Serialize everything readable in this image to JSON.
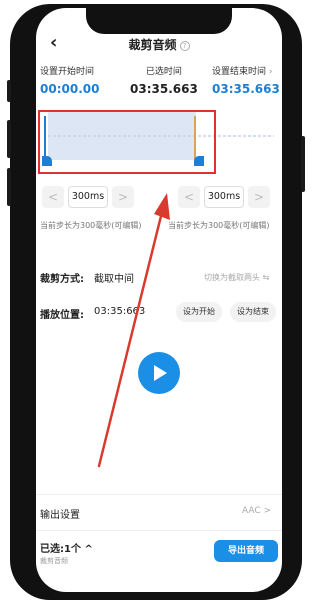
{
  "header": {
    "title": "裁剪音频",
    "info_icon": "info-icon",
    "back_icon": "chevron-left-icon"
  },
  "times": {
    "start_label": "设置开始时间",
    "start_value": "00:00.00",
    "selected_label": "已选时间",
    "selected_value": "03:35.663",
    "end_label": "设置结束时间",
    "end_value": "03:35.663"
  },
  "stepper_left": {
    "dec": "<",
    "value": "300ms",
    "inc": ">",
    "hint": "当前步长为300毫秒(可编辑)"
  },
  "stepper_right": {
    "dec": "<",
    "value": "300ms",
    "inc": ">",
    "hint": "当前步长为300毫秒(可编辑)"
  },
  "trim_mode": {
    "label": "裁剪方式:",
    "value": "截取中间",
    "switch": "切换为截取两头 ⇆"
  },
  "play_position": {
    "label": "播放位置:",
    "value": "03:35:663",
    "set_start": "设为开始",
    "set_end": "设为结束"
  },
  "output": {
    "label": "输出设置",
    "format": "AAC",
    "chevron": ">"
  },
  "footer": {
    "selected": "已选:1个 ^",
    "sub": "裁剪音频",
    "export": "导出音频"
  },
  "colors": {
    "accent": "#1b8fe6",
    "highlight_box": "#e03030",
    "arrow": "#d83a2e"
  }
}
